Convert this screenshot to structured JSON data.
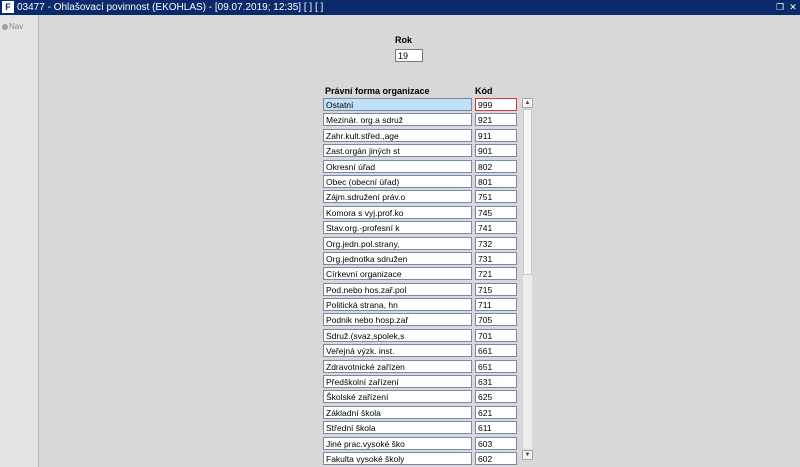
{
  "window": {
    "title": "03477 - Ohlašovací povinnost (EKOHLAS) - [09.07.2019; 12:35] [ ] [ ]"
  },
  "sidebar": {
    "nav_label": "Nav"
  },
  "form": {
    "year_label": "Rok",
    "year_value": "19",
    "col_name": "Právní forma organizace",
    "col_code": "Kód",
    "rows": [
      {
        "name": "Ostatní",
        "code": "999"
      },
      {
        "name": "Mezinár. org.a sdruž",
        "code": "921"
      },
      {
        "name": "Zahr.kult.střed.,age",
        "code": "911"
      },
      {
        "name": "Zast.orgán jiných st",
        "code": "901"
      },
      {
        "name": "Okresní úřad",
        "code": "802"
      },
      {
        "name": "Obec (obecní úřad)",
        "code": "801"
      },
      {
        "name": "Zájm.sdružení práv.o",
        "code": "751"
      },
      {
        "name": "Komora s vyj.prof.ko",
        "code": "745"
      },
      {
        "name": "Stav.org.-profesní k",
        "code": "741"
      },
      {
        "name": "Org.jedn.pol.strany,",
        "code": "732"
      },
      {
        "name": "Org.jednotka sdružen",
        "code": "731"
      },
      {
        "name": "Církevní organizace",
        "code": "721"
      },
      {
        "name": "Pod.nebo hos.zař.pol",
        "code": "715"
      },
      {
        "name": "Politická strana, hn",
        "code": "711"
      },
      {
        "name": "Podnik nebo hosp.zař",
        "code": "705"
      },
      {
        "name": "Sdruž.(svaz,spolek,s",
        "code": "701"
      },
      {
        "name": "Veřejná výzk. inst.",
        "code": "661"
      },
      {
        "name": "Zdravotnické zařízen",
        "code": "651"
      },
      {
        "name": "Předškolní zařízení",
        "code": "631"
      },
      {
        "name": "Školské zařízení",
        "code": "625"
      },
      {
        "name": "Základní škola",
        "code": "621"
      },
      {
        "name": "Střední škola",
        "code": "611"
      },
      {
        "name": "Jiné prac.vysoké ško",
        "code": "603"
      },
      {
        "name": "Fakulta vysoké školy",
        "code": "602"
      }
    ]
  }
}
